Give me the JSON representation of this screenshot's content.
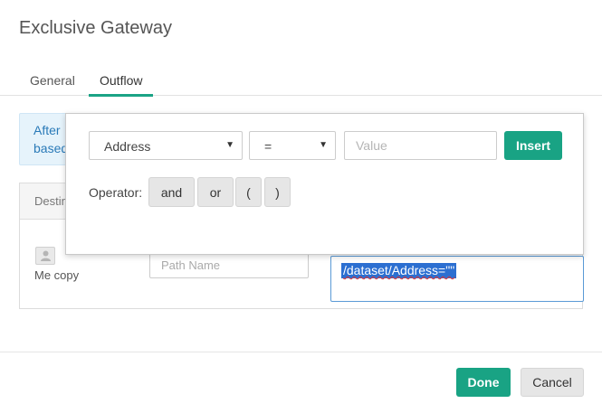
{
  "dialog": {
    "title": "Exclusive Gateway"
  },
  "tabs": [
    {
      "label": "General",
      "active": false
    },
    {
      "label": "Outflow",
      "active": true
    }
  ],
  "info_banner": {
    "line1": "After",
    "line2": "based"
  },
  "table": {
    "header_partial": "Destin",
    "row": {
      "avatar_icon": "person-icon",
      "name": "Me copy",
      "path_placeholder": "Path Name",
      "expression": "/dataset/Address=\"\""
    }
  },
  "condition_builder": {
    "field_value": "Address",
    "operator_value": "=",
    "value_placeholder": "Value",
    "insert_label": "Insert",
    "operator_label": "Operator:",
    "operator_buttons": [
      "and",
      "or",
      "(",
      ")"
    ]
  },
  "footer": {
    "done_label": "Done",
    "cancel_label": "Cancel"
  },
  "colors": {
    "accent": "#19a384",
    "selection": "#2c6fd1",
    "info_bg": "#e6f3fb"
  }
}
